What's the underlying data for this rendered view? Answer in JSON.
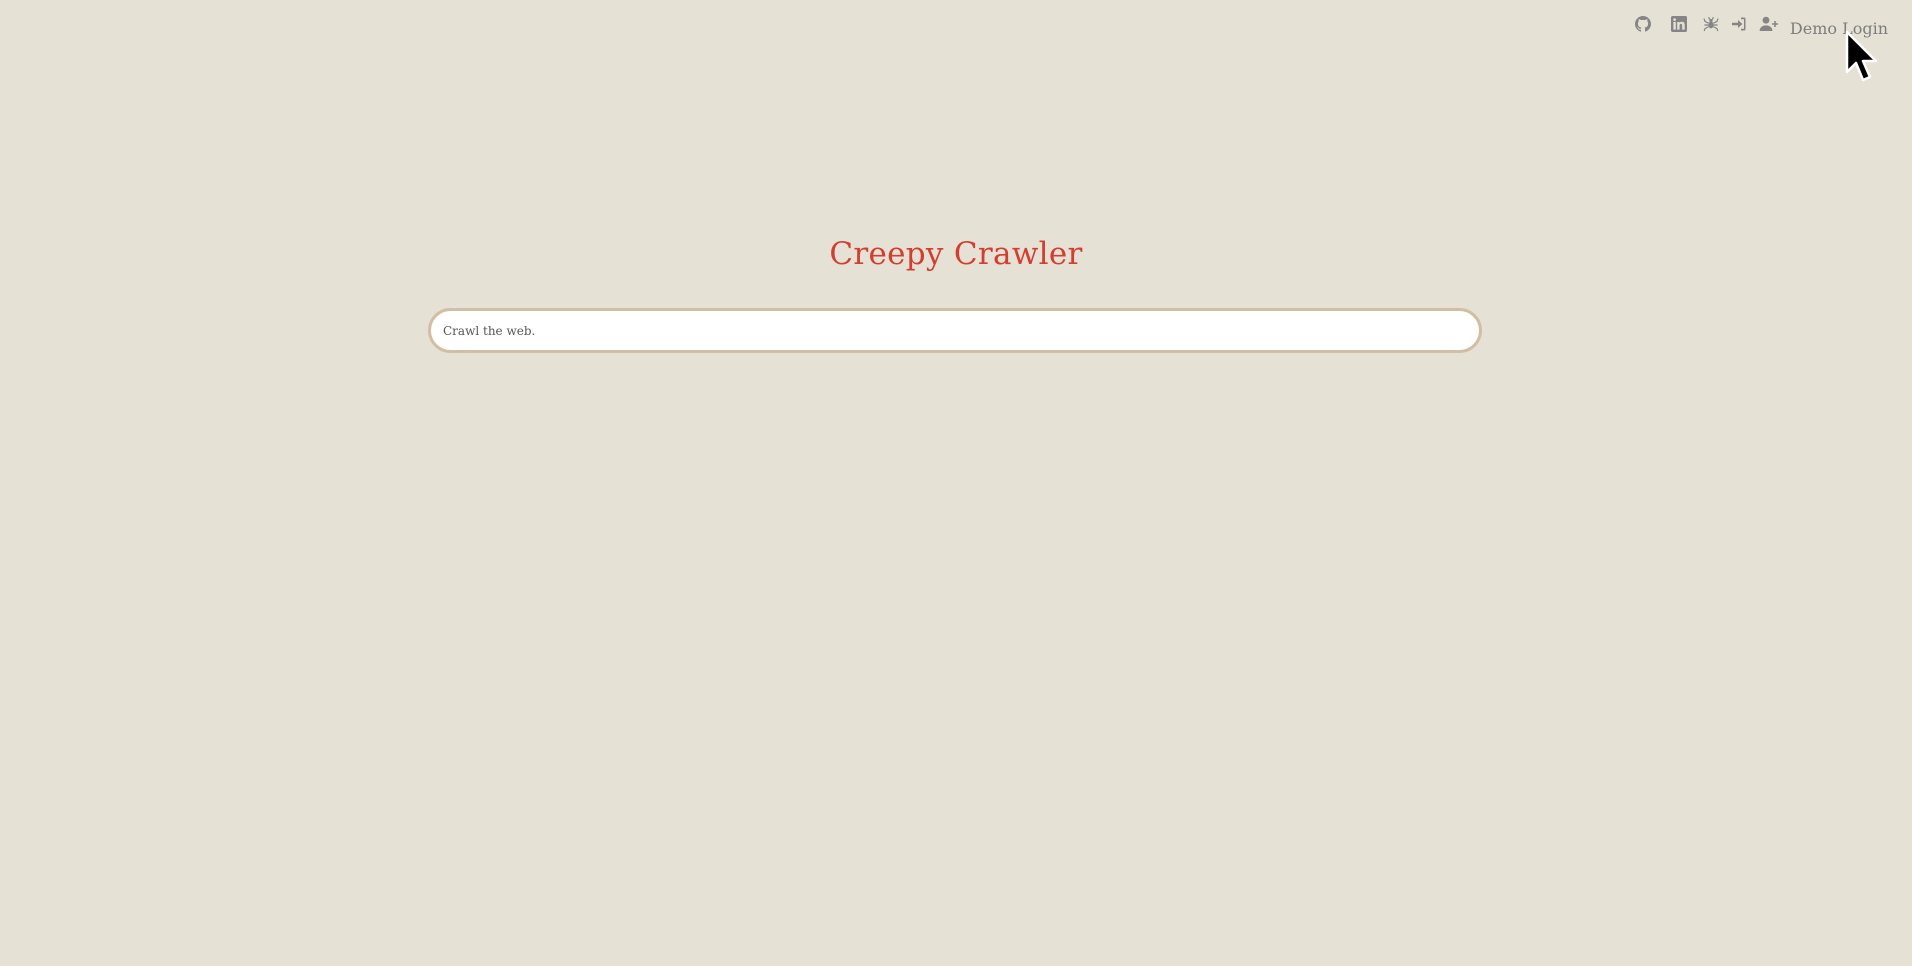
{
  "header": {
    "icons": [
      {
        "name": "github-icon"
      },
      {
        "name": "linkedin-icon"
      },
      {
        "name": "spider-icon"
      },
      {
        "name": "sign-in-icon"
      },
      {
        "name": "user-plus-icon"
      }
    ],
    "demo_login_label": "Demo Login"
  },
  "main": {
    "title": "Creepy Crawler",
    "search": {
      "placeholder": "Crawl the web.",
      "value": ""
    }
  },
  "colors": {
    "background": "#e5e1d5",
    "title": "#d23f31",
    "search_border": "#d2bea4",
    "icon": "#858585"
  }
}
